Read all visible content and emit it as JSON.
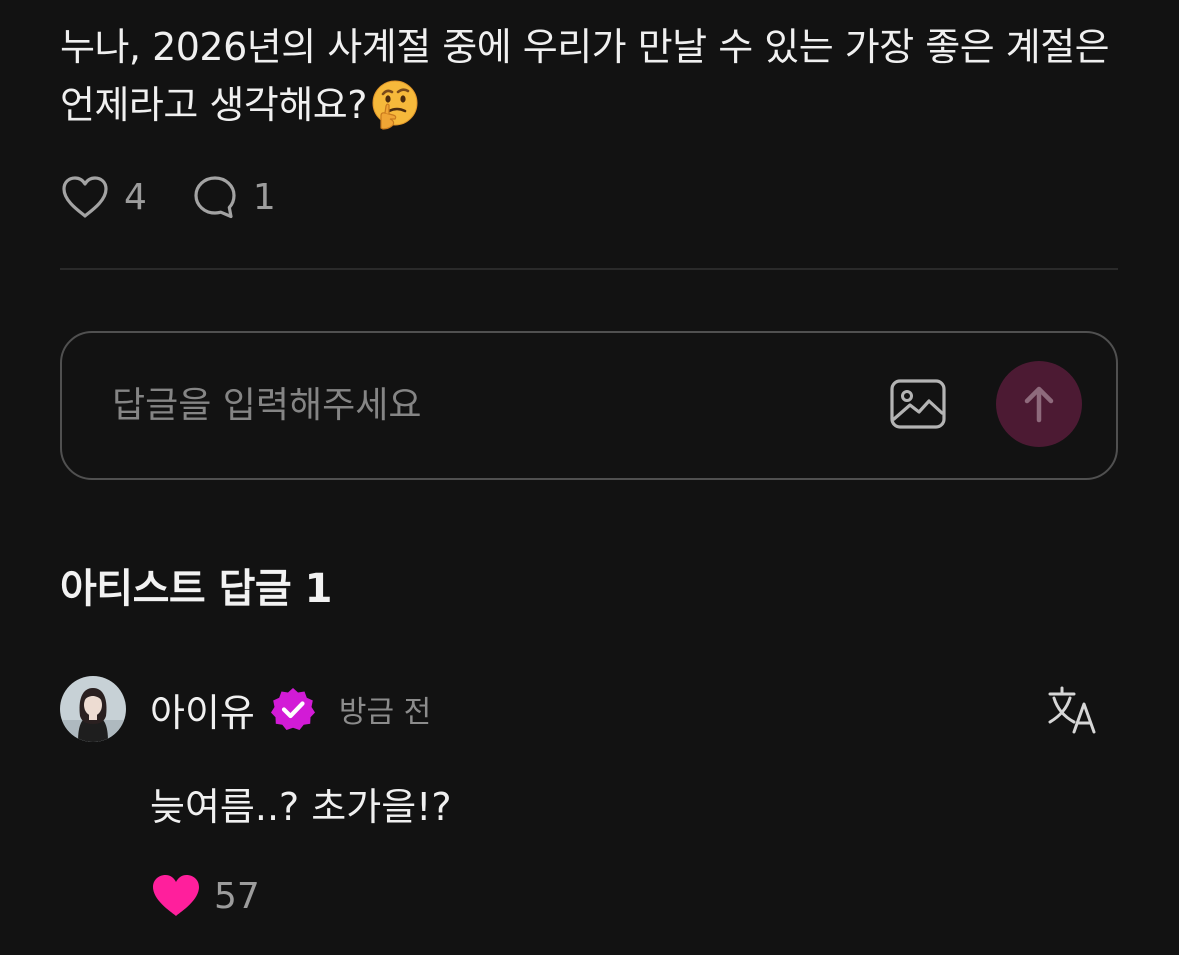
{
  "post": {
    "text": "누나, 2026년의 사계절 중에 우리가 만날 수 있는 가장 좋은 계절은 언제라고 생각해요?",
    "emoji": "thinking-face",
    "like_count": "4",
    "comment_count": "1"
  },
  "reply": {
    "placeholder": "답글을 입력해주세요",
    "value": ""
  },
  "artist_section": {
    "title": "아티스트 답글 1"
  },
  "comment": {
    "author": "아이유",
    "time": "방금 전",
    "text": "늦여름..? 초가을!?",
    "like_count": "57"
  },
  "colors": {
    "background": "#121212",
    "send_button": "#4c1a33",
    "verified_badge": "#d21bd6",
    "liked_heart": "#ff1f9c",
    "muted_text": "#9c9c9c"
  },
  "icons": {
    "like": "heart-outline-icon",
    "comment": "speech-bubble-icon",
    "attach_image": "image-icon",
    "send": "arrow-up-icon",
    "verified": "verified-badge-icon",
    "translate": "translate-icon",
    "liked": "heart-filled-icon"
  }
}
